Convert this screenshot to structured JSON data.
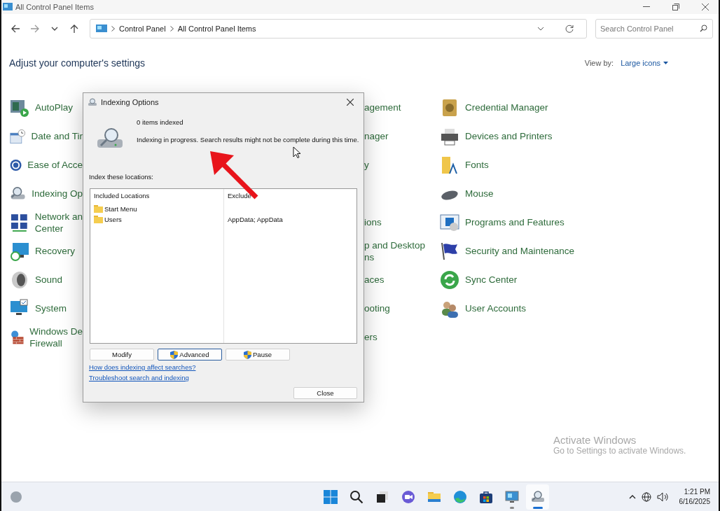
{
  "window": {
    "title": "All Control Panel Items"
  },
  "address": {
    "crumbs": [
      "Control Panel",
      "All Control Panel Items"
    ]
  },
  "search": {
    "placeholder": "Search Control Panel"
  },
  "heading": "Adjust your computer's settings",
  "view_by": {
    "label": "View by:",
    "value": "Large icons"
  },
  "rows": [
    {
      "left": [
        "AutoPlay"
      ],
      "middle": [
        "agement"
      ],
      "right": [
        "Credential Manager"
      ]
    },
    {
      "left": [
        "Date and Tir"
      ],
      "middle": [
        "nager"
      ],
      "right": [
        "Devices and Printers"
      ]
    },
    {
      "left": [
        "Ease of Acce"
      ],
      "middle": [
        "y"
      ],
      "right": [
        "Fonts"
      ]
    },
    {
      "left": [
        "Indexing Op"
      ],
      "right": [
        "Mouse"
      ]
    },
    {
      "left": [
        "Network an",
        "Center"
      ],
      "middle": [
        "ions"
      ],
      "right": [
        "Programs and Features"
      ]
    },
    {
      "left": [
        "Recovery"
      ],
      "middle": [
        "p and Desktop",
        "ns"
      ],
      "right": [
        "Security and Maintenance"
      ]
    },
    {
      "left": [
        "Sound"
      ],
      "middle": [
        "aces"
      ],
      "right": [
        "Sync Center"
      ]
    },
    {
      "left": [
        "System"
      ],
      "middle": [
        "ooting"
      ],
      "right": [
        "User Accounts"
      ]
    },
    {
      "left": [
        "Windows De",
        "Firewall"
      ],
      "middle": [
        "ers"
      ]
    }
  ],
  "dialog": {
    "title": "Indexing Options",
    "count": "0 items indexed",
    "status": "Indexing in progress. Search results might not be complete during this time.",
    "list_label": "Index these locations:",
    "columns": [
      "Included Locations",
      "Exclude"
    ],
    "locations": [
      {
        "name": "Start Menu"
      },
      {
        "name": "Users",
        "excluded": "AppData; AppData"
      }
    ],
    "buttons": [
      {
        "label": "Modify",
        "shield": false,
        "focused": false
      },
      {
        "label": "Advanced",
        "shield": true,
        "focused": true
      },
      {
        "label": "Pause",
        "shield": true,
        "focused": false
      }
    ],
    "links": [
      "How does indexing affect searches?",
      "Troubleshoot search and indexing"
    ],
    "close": "Close"
  },
  "overlay": {
    "arrow": true,
    "cursor": true
  },
  "activation": {
    "title": "Activate Windows",
    "text": "Go to Settings to activate Windows."
  },
  "taskbar": {
    "apps": [
      {
        "running": false,
        "selected": false
      },
      {
        "running": false,
        "selected": false
      },
      {
        "running": false,
        "selected": false
      },
      {
        "running": false,
        "selected": false
      },
      {
        "running": false,
        "selected": false
      },
      {
        "running": false,
        "selected": false
      },
      {
        "running": false,
        "selected": false
      },
      {
        "running": true,
        "selected": false
      },
      {
        "running": true,
        "selected": true
      }
    ],
    "time": "1:21 PM",
    "date": "6/16/2025"
  }
}
